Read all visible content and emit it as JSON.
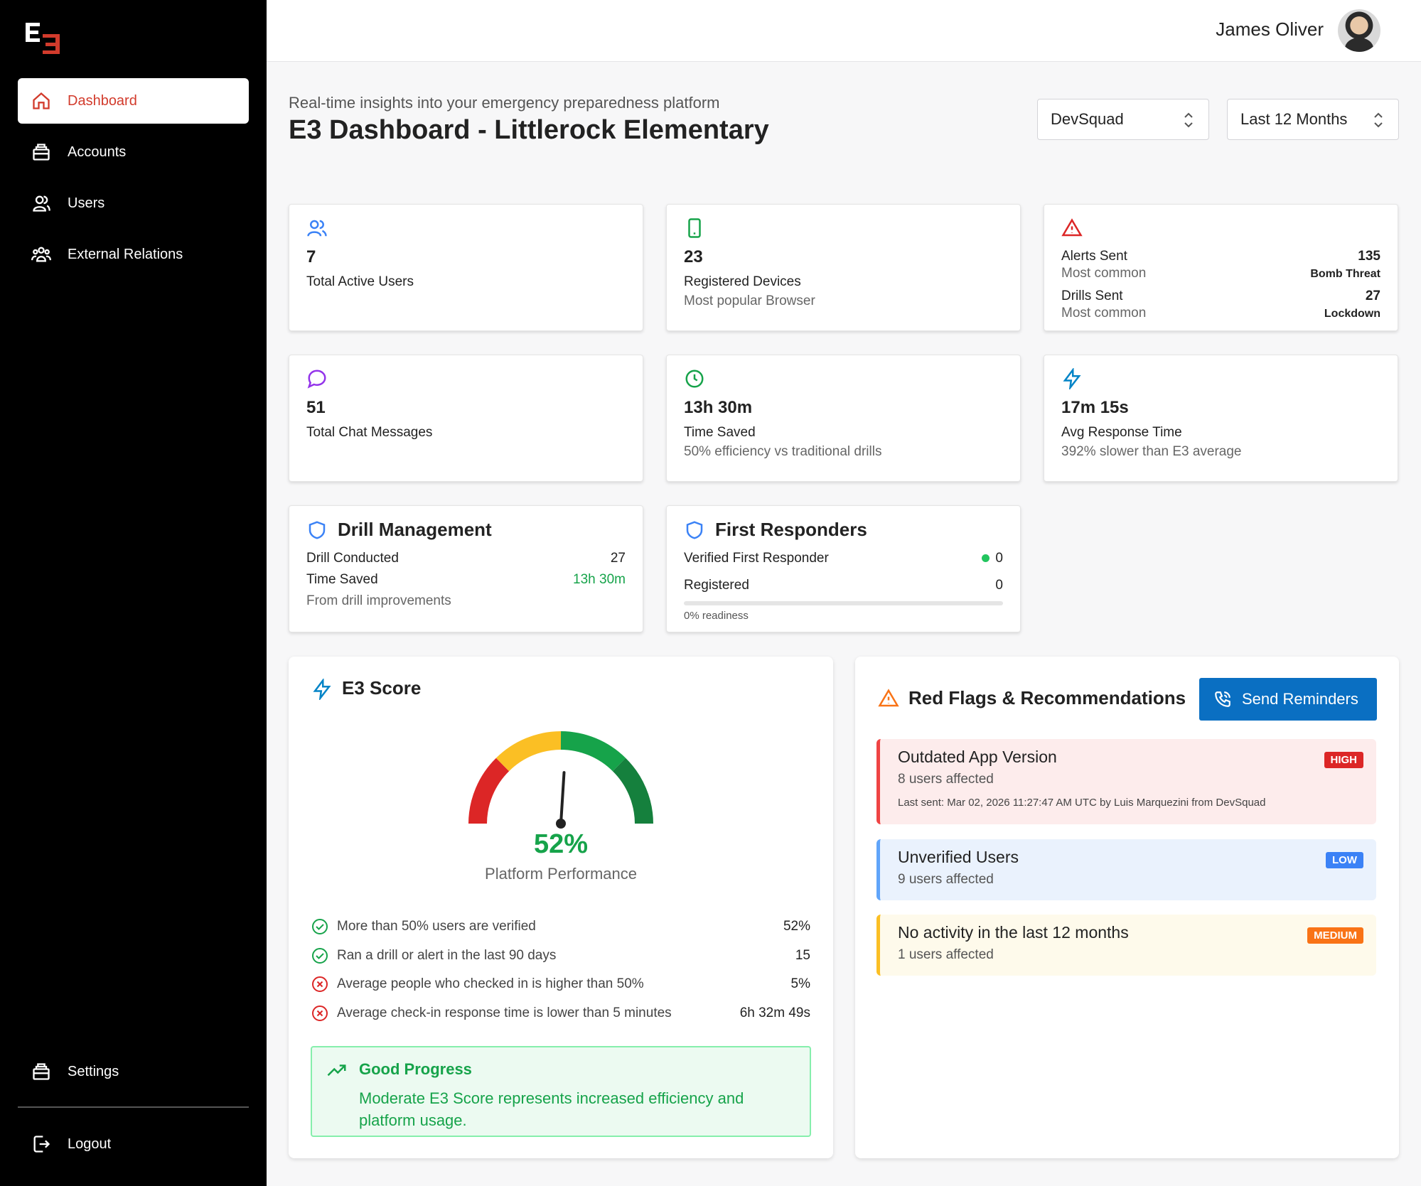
{
  "sidebar": {
    "logo_text": "E3",
    "items": [
      {
        "label": "Dashboard",
        "icon": "home-icon"
      },
      {
        "label": "Accounts",
        "icon": "briefcase-icon"
      },
      {
        "label": "Users",
        "icon": "users-icon"
      },
      {
        "label": "External Relations",
        "icon": "group-icon"
      }
    ],
    "settings_label": "Settings",
    "logout_label": "Logout"
  },
  "topbar": {
    "user_name": "James Oliver"
  },
  "header": {
    "subtitle": "Real-time insights into your emergency preparedness platform",
    "title": "E3 Dashboard - Littlerock Elementary",
    "org_select": "DevSquad",
    "range_select": "Last 12 Months"
  },
  "stats": {
    "users": {
      "value": "7",
      "label": "Total Active Users",
      "color": "#3b82f6"
    },
    "devices": {
      "value": "23",
      "label": "Registered Devices",
      "sub": "Most popular Browser",
      "color": "#16a34a"
    },
    "alerts": {
      "alerts_label": "Alerts Sent",
      "alerts_value": "135",
      "alerts_common_label": "Most common",
      "alerts_common": "Bomb Threat",
      "drills_label": "Drills Sent",
      "drills_value": "27",
      "drills_common_label": "Most common",
      "drills_common": "Lockdown",
      "color": "#dc2626"
    },
    "chat": {
      "value": "51",
      "label": "Total Chat Messages",
      "color": "#9333ea"
    },
    "time": {
      "value": "13h 30m",
      "label": "Time Saved",
      "sub": "50% efficiency vs traditional drills",
      "color": "#16a34a"
    },
    "response": {
      "value": "17m 15s",
      "label": "Avg Response Time",
      "sub": "392% slower than E3 average",
      "color": "#0284c7"
    }
  },
  "drill": {
    "title": "Drill Management",
    "conducted_label": "Drill Conducted",
    "conducted_value": "27",
    "saved_label": "Time Saved",
    "saved_value": "13h 30m",
    "note": "From drill improvements"
  },
  "responders": {
    "title": "First Responders",
    "verified_label": "Verified First Responder",
    "verified_value": "0",
    "registered_label": "Registered",
    "registered_value": "0",
    "readiness": "0% readiness",
    "readiness_fraction": 0
  },
  "score": {
    "title": "E3 Score",
    "value": "52%",
    "fraction": 0.52,
    "caption": "Platform Performance",
    "criteria": [
      {
        "text": "More than 50% users are verified",
        "value": "52%",
        "pass": true
      },
      {
        "text": "Ran a drill or alert in the last 90 days",
        "value": "15",
        "pass": true
      },
      {
        "text": "Average people who checked in is higher than 50%",
        "value": "5%",
        "pass": false
      },
      {
        "text": "Average check-in response time is lower than 5 minutes",
        "value": "6h 32m 49s",
        "pass": false
      }
    ],
    "progress_title": "Good Progress",
    "progress_text": "Moderate E3 Score represents increased efficiency and platform usage."
  },
  "flags": {
    "title": "Red Flags & Recommendations",
    "button": "Send Reminders",
    "items": [
      {
        "title": "Outdated App Version",
        "sub": "8 users affected",
        "badge": "HIGH",
        "note": "Last sent: Mar 02, 2026 11:27:47 AM UTC by Luis Marquezini from DevSquad",
        "color": "#ef4444",
        "bg": "#fdecec"
      },
      {
        "title": "Unverified Users",
        "sub": "9 users affected",
        "badge": "LOW",
        "color": "#60a5fa",
        "bg": "#eaf2fd"
      },
      {
        "title": "No activity in the last 12 months",
        "sub": "1 users affected",
        "badge": "MEDIUM",
        "color": "#fbbf24",
        "bg": "#fefaeb"
      }
    ]
  }
}
